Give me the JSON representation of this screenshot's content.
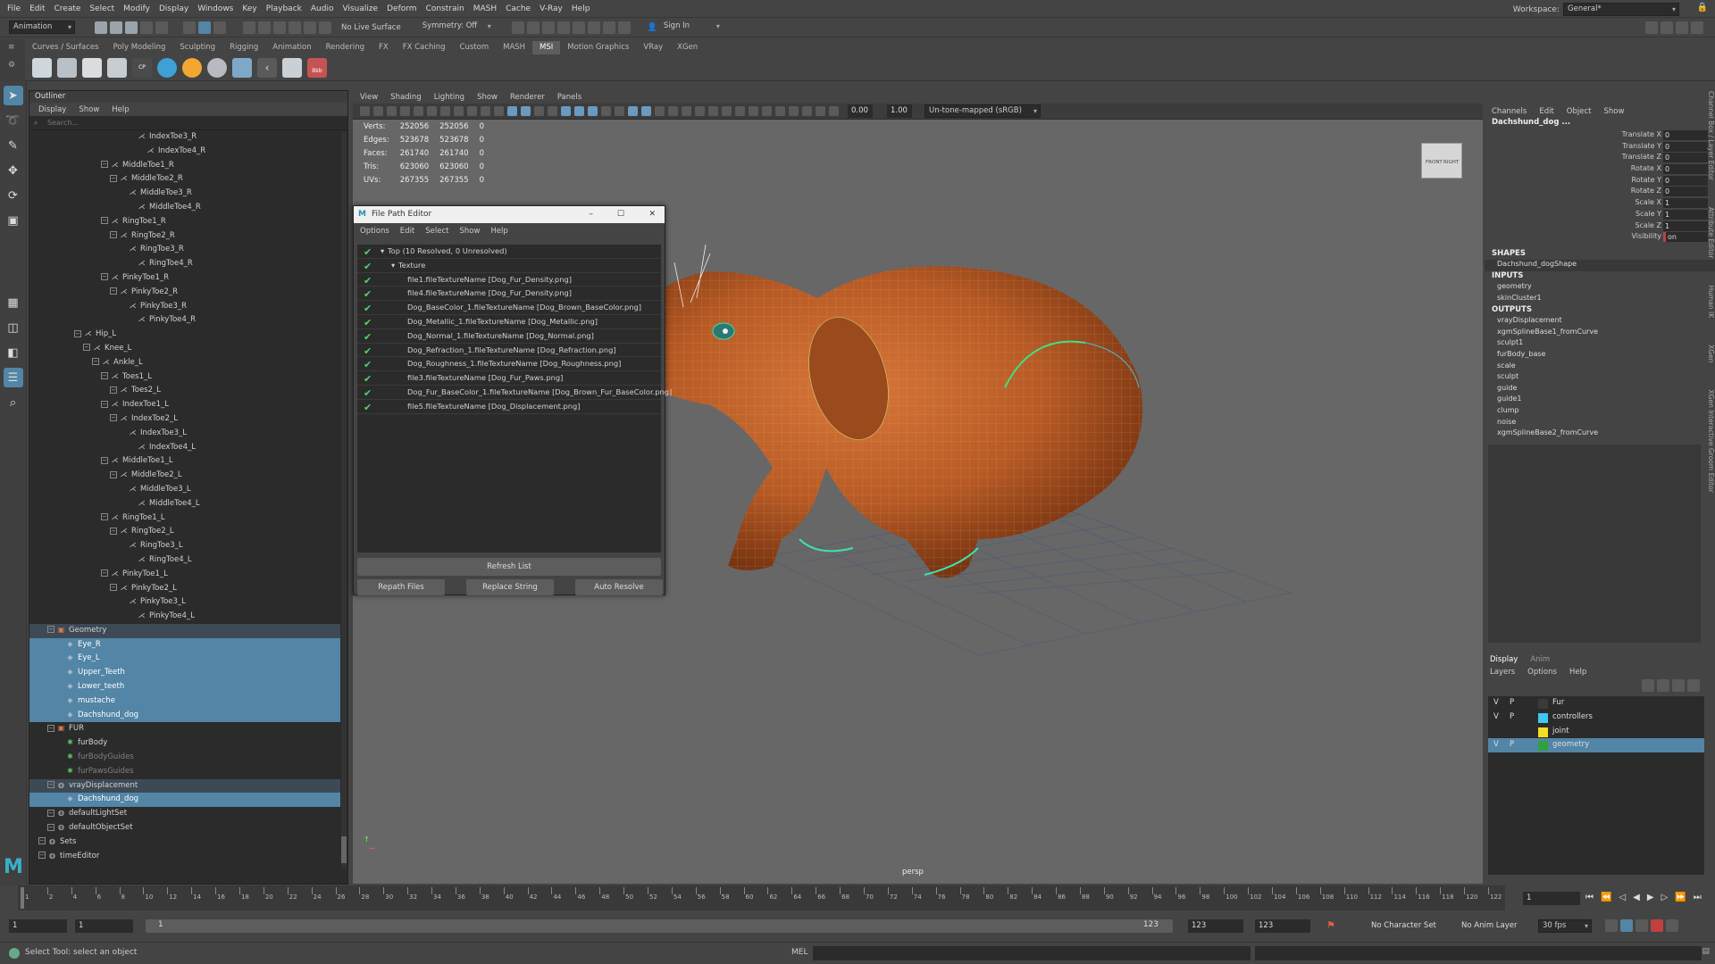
{
  "menubar": {
    "items": [
      "File",
      "Edit",
      "Create",
      "Select",
      "Modify",
      "Display",
      "Windows",
      "Key",
      "Playback",
      "Audio",
      "Visualize",
      "Deform",
      "Constrain",
      "MASH",
      "Cache",
      "V-Ray",
      "Help"
    ],
    "workspace_label": "Workspace:",
    "workspace_value": "General*"
  },
  "statusline": {
    "mode": "Animation",
    "live_surface": "No Live Surface",
    "symmetry": "Symmetry: Off",
    "sign_in": "Sign In"
  },
  "shelf": {
    "tabs": [
      "Curves / Surfaces",
      "Poly Modeling",
      "Sculpting",
      "Rigging",
      "Animation",
      "Rendering",
      "FX",
      "FX Caching",
      "Custom",
      "MASH",
      "MSI",
      "Motion Graphics",
      "VRay",
      "XGen"
    ],
    "active": "MSI",
    "icon_badge_1": "CP",
    "icon_badge_2": "Bkb"
  },
  "outliner": {
    "title": "Outliner",
    "menu": [
      "Display",
      "Show",
      "Help"
    ],
    "search_placeholder": "Search...",
    "rows": [
      {
        "label": "IndexToe3_R",
        "depth": 11,
        "icon": "joint"
      },
      {
        "label": "IndexToe4_R",
        "depth": 12,
        "icon": "joint"
      },
      {
        "label": "MiddleToe1_R",
        "depth": 8,
        "icon": "joint"
      },
      {
        "label": "MiddleToe2_R",
        "depth": 9,
        "icon": "joint"
      },
      {
        "label": "MiddleToe3_R",
        "depth": 10,
        "icon": "joint"
      },
      {
        "label": "MiddleToe4_R",
        "depth": 11,
        "icon": "joint"
      },
      {
        "label": "RingToe1_R",
        "depth": 8,
        "icon": "joint"
      },
      {
        "label": "RingToe2_R",
        "depth": 9,
        "icon": "joint"
      },
      {
        "label": "RingToe3_R",
        "depth": 10,
        "icon": "joint"
      },
      {
        "label": "RingToe4_R",
        "depth": 11,
        "icon": "joint"
      },
      {
        "label": "PinkyToe1_R",
        "depth": 8,
        "icon": "joint"
      },
      {
        "label": "PinkyToe2_R",
        "depth": 9,
        "icon": "joint"
      },
      {
        "label": "PinkyToe3_R",
        "depth": 10,
        "icon": "joint"
      },
      {
        "label": "PinkyToe4_R",
        "depth": 11,
        "icon": "joint"
      },
      {
        "label": "Hip_L",
        "depth": 5,
        "icon": "joint"
      },
      {
        "label": "Knee_L",
        "depth": 6,
        "icon": "joint"
      },
      {
        "label": "Ankle_L",
        "depth": 7,
        "icon": "joint"
      },
      {
        "label": "Toes1_L",
        "depth": 8,
        "icon": "joint"
      },
      {
        "label": "Toes2_L",
        "depth": 9,
        "icon": "joint"
      },
      {
        "label": "IndexToe1_L",
        "depth": 8,
        "icon": "joint"
      },
      {
        "label": "IndexToe2_L",
        "depth": 9,
        "icon": "joint"
      },
      {
        "label": "IndexToe3_L",
        "depth": 10,
        "icon": "joint"
      },
      {
        "label": "IndexToe4_L",
        "depth": 11,
        "icon": "joint"
      },
      {
        "label": "MiddleToe1_L",
        "depth": 8,
        "icon": "joint"
      },
      {
        "label": "MiddleToe2_L",
        "depth": 9,
        "icon": "joint"
      },
      {
        "label": "MiddleToe3_L",
        "depth": 10,
        "icon": "joint"
      },
      {
        "label": "MiddleToe4_L",
        "depth": 11,
        "icon": "joint"
      },
      {
        "label": "RingToe1_L",
        "depth": 8,
        "icon": "joint"
      },
      {
        "label": "RingToe2_L",
        "depth": 9,
        "icon": "joint"
      },
      {
        "label": "RingToe3_L",
        "depth": 10,
        "icon": "joint"
      },
      {
        "label": "RingToe4_L",
        "depth": 11,
        "icon": "joint"
      },
      {
        "label": "PinkyToe1_L",
        "depth": 8,
        "icon": "joint"
      },
      {
        "label": "PinkyToe2_L",
        "depth": 9,
        "icon": "joint"
      },
      {
        "label": "PinkyToe3_L",
        "depth": 10,
        "icon": "joint"
      },
      {
        "label": "PinkyToe4_L",
        "depth": 11,
        "icon": "joint"
      },
      {
        "label": "Geometry",
        "depth": 2,
        "icon": "group",
        "state": "hl"
      },
      {
        "label": "Eye_R",
        "depth": 3,
        "icon": "mesh",
        "state": "sel"
      },
      {
        "label": "Eye_L",
        "depth": 3,
        "icon": "mesh",
        "state": "sel"
      },
      {
        "label": "Upper_Teeth",
        "depth": 3,
        "icon": "mesh",
        "state": "sel"
      },
      {
        "label": "Lower_teeth",
        "depth": 3,
        "icon": "mesh",
        "state": "sel"
      },
      {
        "label": "mustache",
        "depth": 3,
        "icon": "mesh",
        "state": "sel"
      },
      {
        "label": "Dachshund_dog",
        "depth": 3,
        "icon": "mesh",
        "state": "sel"
      },
      {
        "label": "FUR",
        "depth": 2,
        "icon": "group"
      },
      {
        "label": "furBody",
        "depth": 3,
        "icon": "fur"
      },
      {
        "label": "furBodyGuides",
        "depth": 3,
        "icon": "fur",
        "state": "dim"
      },
      {
        "label": "furPawsGuides",
        "depth": 3,
        "icon": "fur",
        "state": "dim"
      },
      {
        "label": "vrayDisplacement",
        "depth": 2,
        "icon": "set",
        "state": "hl"
      },
      {
        "label": "Dachshund_dog",
        "depth": 3,
        "icon": "mesh",
        "state": "sel"
      },
      {
        "label": "defaultLightSet",
        "depth": 2,
        "icon": "set"
      },
      {
        "label": "defaultObjectSet",
        "depth": 2,
        "icon": "set"
      },
      {
        "label": "Sets",
        "depth": 1,
        "icon": "set"
      },
      {
        "label": "timeEditor",
        "depth": 1,
        "icon": "set"
      }
    ]
  },
  "viewport": {
    "menu": [
      "View",
      "Shading",
      "Lighting",
      "Show",
      "Renderer",
      "Panels"
    ],
    "exposure": "0.00",
    "gamma": "1.00",
    "colorspace": "Un-tone-mapped (sRGB)",
    "camera_label": "persp",
    "viewcube_front": "FRONT",
    "viewcube_right": "RIGHT",
    "hud": [
      {
        "label": "Verts:",
        "a": "252056",
        "b": "252056",
        "c": "0"
      },
      {
        "label": "Edges:",
        "a": "523678",
        "b": "523678",
        "c": "0"
      },
      {
        "label": "Faces:",
        "a": "261740",
        "b": "261740",
        "c": "0"
      },
      {
        "label": "Tris:",
        "a": "623060",
        "b": "623060",
        "c": "0"
      },
      {
        "label": "UVs:",
        "a": "267355",
        "b": "267355",
        "c": "0"
      }
    ]
  },
  "file_path_editor": {
    "title": "File Path Editor",
    "menu": [
      "Options",
      "Edit",
      "Select",
      "Show",
      "Help"
    ],
    "root": "Top (10 Resolved, 0 Unresolved)",
    "folder": "Texture",
    "files": [
      "file1.fileTextureName [Dog_Fur_Density.png]",
      "file4.fileTextureName [Dog_Fur_Density.png]",
      "Dog_BaseColor_1.fileTextureName [Dog_Brown_BaseColor.png]",
      "Dog_Metallic_1.fileTextureName [Dog_Metallic.png]",
      "Dog_Normal_1.fileTextureName [Dog_Normal.png]",
      "Dog_Refraction_1.fileTextureName [Dog_Refraction.png]",
      "Dog_Roughness_1.fileTextureName [Dog_Roughness.png]",
      "file3.fileTextureName [Dog_Fur_Paws.png]",
      "Dog_Fur_BaseColor_1.fileTextureName [Dog_Brown_Fur_BaseColor.png]",
      "file5.fileTextureName [Dog_Displacement.png]"
    ],
    "refresh": "Refresh List",
    "repath": "Repath Files",
    "replace": "Replace String",
    "auto": "Auto Resolve"
  },
  "channel_box": {
    "menu": [
      "Channels",
      "Edit",
      "Object",
      "Show"
    ],
    "object": "Dachshund_dog ...",
    "attrs": [
      {
        "n": "Translate X",
        "v": "0"
      },
      {
        "n": "Translate Y",
        "v": "0"
      },
      {
        "n": "Translate Z",
        "v": "0"
      },
      {
        "n": "Rotate X",
        "v": "0"
      },
      {
        "n": "Rotate Y",
        "v": "0"
      },
      {
        "n": "Rotate Z",
        "v": "0"
      },
      {
        "n": "Scale X",
        "v": "1"
      },
      {
        "n": "Scale Y",
        "v": "1"
      },
      {
        "n": "Scale Z",
        "v": "1"
      },
      {
        "n": "Visibility",
        "v": "on"
      }
    ],
    "shapes_label": "SHAPES",
    "shape": "Dachshund_dogShape",
    "inputs_label": "INPUTS",
    "inputs": [
      "geometry",
      "skinCluster1"
    ],
    "outputs_label": "OUTPUTS",
    "outputs": [
      "vrayDisplacement",
      "xgmSplineBase1_fromCurve",
      "sculpt1",
      "furBody_base",
      "scale",
      "sculpt",
      "guide",
      "guide1",
      "clump",
      "noise",
      "xgmSplineBase2_fromCurve"
    ]
  },
  "layers": {
    "tabs": [
      "Display",
      "Anim"
    ],
    "menu": [
      "Layers",
      "Options",
      "Help"
    ],
    "items": [
      {
        "v": "V",
        "p": "P",
        "name": "Fur",
        "color": "#3a3a3a"
      },
      {
        "v": "V",
        "p": "P",
        "name": "controllers",
        "color": "#40c8f0"
      },
      {
        "v": "",
        "p": "",
        "name": "joint",
        "color": "#f0e020"
      },
      {
        "v": "V",
        "p": "P",
        "name": "geometry",
        "color": "#30a040"
      }
    ]
  },
  "side_tabs": [
    "Channel Box / Layer Editor",
    "Attribute Editor",
    "Human IK",
    "XGen",
    "XGen Interactive Groom Editor"
  ],
  "timeline": {
    "ticks": [
      "1",
      "2",
      "4",
      "6",
      "8",
      "10",
      "12",
      "14",
      "16",
      "18",
      "20",
      "22",
      "24",
      "26",
      "28",
      "30",
      "32",
      "34",
      "36",
      "38",
      "40",
      "42",
      "44",
      "46",
      "48",
      "50",
      "52",
      "54",
      "56",
      "58",
      "60",
      "62",
      "64",
      "66",
      "68",
      "70",
      "72",
      "74",
      "76",
      "78",
      "80",
      "82",
      "84",
      "86",
      "88",
      "90",
      "92",
      "94",
      "96",
      "98",
      "100",
      "102",
      "104",
      "106",
      "108",
      "110",
      "112",
      "114",
      "116",
      "118",
      "120",
      "122"
    ],
    "current": "1"
  },
  "range": {
    "start": "1",
    "start2": "1",
    "slider_start": "1",
    "slider_end": "123",
    "end": "123",
    "end2": "123",
    "char_set": "No Character Set",
    "anim_layer": "No Anim Layer",
    "fps": "30 fps"
  },
  "helpline": {
    "text": "Select Tool: select an object",
    "mel": "MEL"
  }
}
